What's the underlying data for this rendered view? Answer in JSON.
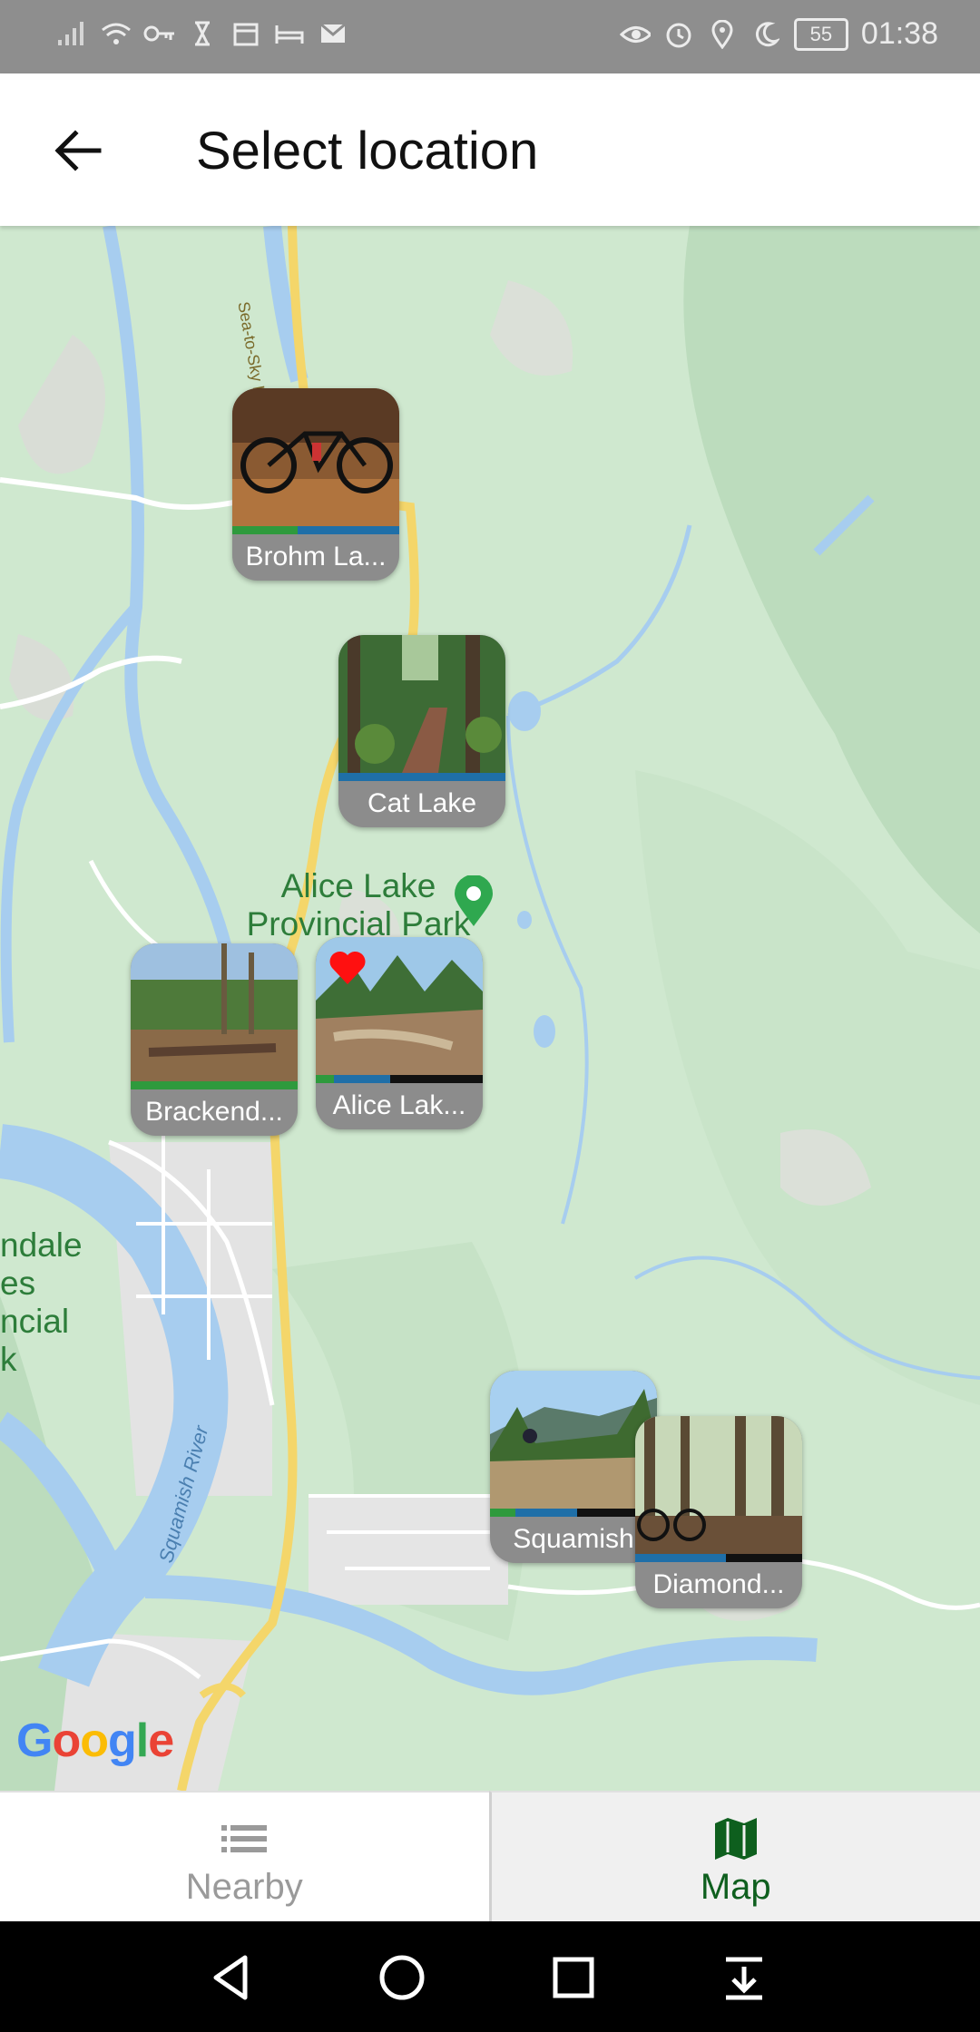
{
  "status_bar": {
    "time": "01:38",
    "battery": "55",
    "left_icons": [
      "signal-icon",
      "wifi-icon",
      "key-icon",
      "hourglass-icon",
      "calendar-icon",
      "bed-icon",
      "mail-icon"
    ],
    "right_icons": [
      "eye-icon",
      "alarm-icon",
      "location-icon",
      "moon-icon"
    ]
  },
  "app_bar": {
    "title": "Select location"
  },
  "map": {
    "labels": {
      "park": "Alice Lake\nProvincial Park",
      "left_park": "ndale\nes\nncial\nk",
      "highway": "Sea-to-Sky Hwy",
      "river": "Squamish River"
    },
    "google": "Google",
    "markers": [
      {
        "label": "Brohm La...",
        "bar": [
          "#2e9a3d",
          "#1f6fa8",
          "#1f6fa8"
        ],
        "photo": "bike",
        "favorite": false
      },
      {
        "label": "Cat Lake",
        "bar": [
          "#1f6fa8",
          "#1f6fa8",
          "#1f6fa8"
        ],
        "photo": "forest-boardwalk",
        "favorite": false
      },
      {
        "label": "Brackend...",
        "bar": [
          "#2e9a3d",
          "#2e9a3d",
          "#2e9a3d"
        ],
        "photo": "clearing",
        "favorite": false
      },
      {
        "label": "Alice Lak...",
        "bar": [
          "#2e9a3d",
          "#1f6fa8",
          "#111111"
        ],
        "photo": "rock-slab",
        "favorite": true
      },
      {
        "label": "Squamish",
        "bar": [
          "#2e9a3d",
          "#1f6fa8",
          "#111111"
        ],
        "photo": "mountain-rider",
        "favorite": false
      },
      {
        "label": "Diamond...",
        "bar": [
          "#1f6fa8",
          "#1f6fa8",
          "#111111"
        ],
        "photo": "tall-trees",
        "favorite": false
      }
    ]
  },
  "bottom_nav": {
    "tabs": [
      {
        "label": "Nearby",
        "icon": "list-icon",
        "active": false
      },
      {
        "label": "Map",
        "icon": "map-icon",
        "active": true
      }
    ]
  },
  "system_nav": [
    "back-triangle-icon",
    "home-circle-icon",
    "recents-square-icon",
    "notification-pull-icon"
  ],
  "colors": {
    "accent": "#0e5f1e",
    "map_green": "#cfe8cf",
    "water": "#a7cdef",
    "road": "#f4d66a"
  }
}
